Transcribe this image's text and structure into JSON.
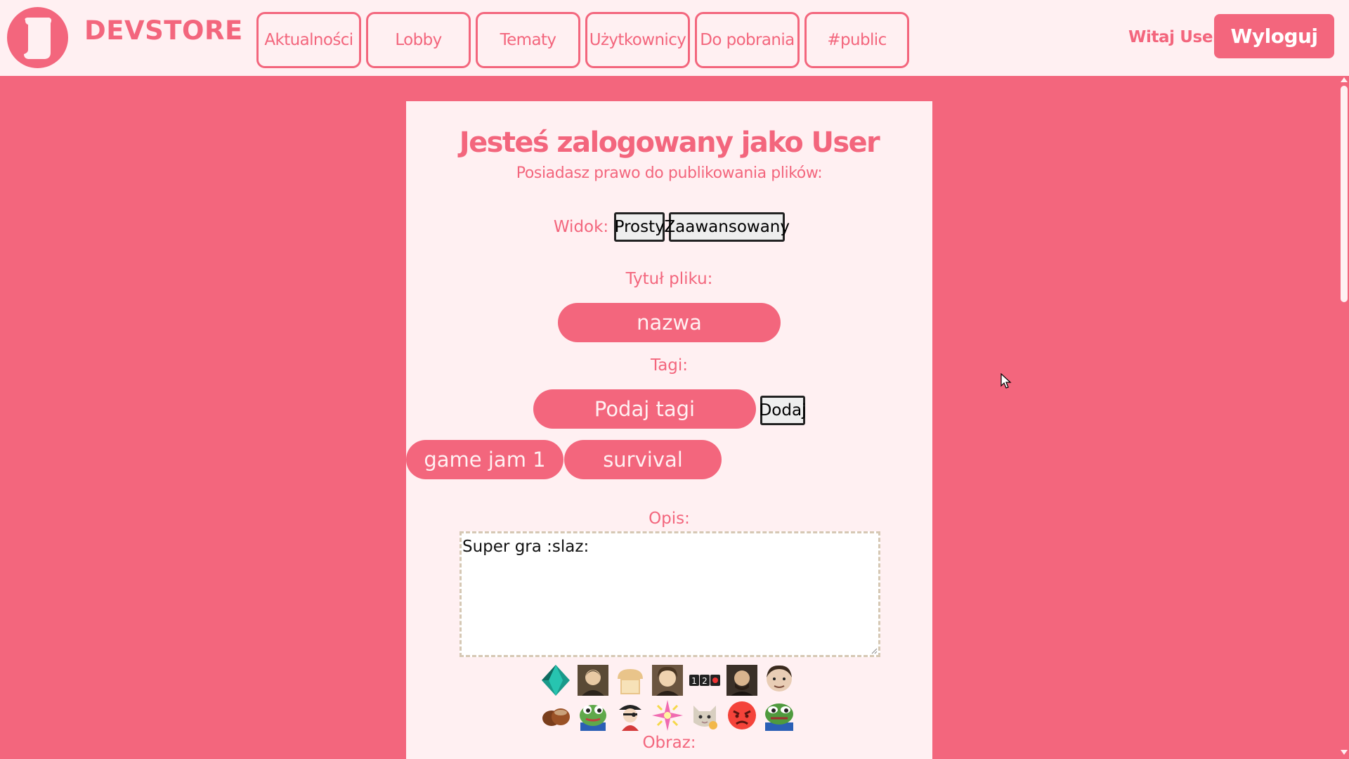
{
  "header": {
    "brand": "DEVSTORE",
    "nav": [
      "Aktualności",
      "Lobby",
      "Tematy",
      "Użytkownicy",
      "Do pobrania",
      "#public"
    ],
    "welcome": "Witaj User!",
    "logout_label": "Wyloguj"
  },
  "form": {
    "heading": "Jesteś zalogowany jako User",
    "subheading": "Posiadasz prawo do publikowania plików:",
    "view_label": "Widok:",
    "view_options": [
      "Prosty",
      "Zaawansowany"
    ],
    "title_label": "Tytuł pliku:",
    "title_input_placeholder": "nazwa",
    "tags_label": "Tagi:",
    "tags_input_placeholder": "Podaj tagi",
    "tags_add_label": "Dodaj",
    "tags": [
      "game jam 1",
      "survival"
    ],
    "description_label": "Opis:",
    "description_value": "Super gra :slaz:",
    "image_label": "Obraz:"
  },
  "emojis": [
    "diamond-emoji",
    "portrait-emoji-1",
    "bread-emoji",
    "portrait-emoji-2",
    "numbers-emoji",
    "portrait-emoji-3",
    "face-emoji",
    "chestnut-emoji",
    "frog-emoji-1",
    "pirate-emoji",
    "sparkle-emoji",
    "cat-emoji",
    "angry-emoji",
    "frog-emoji-2"
  ],
  "colors": {
    "accent": "#f3667d",
    "panel": "#fff0f2"
  }
}
